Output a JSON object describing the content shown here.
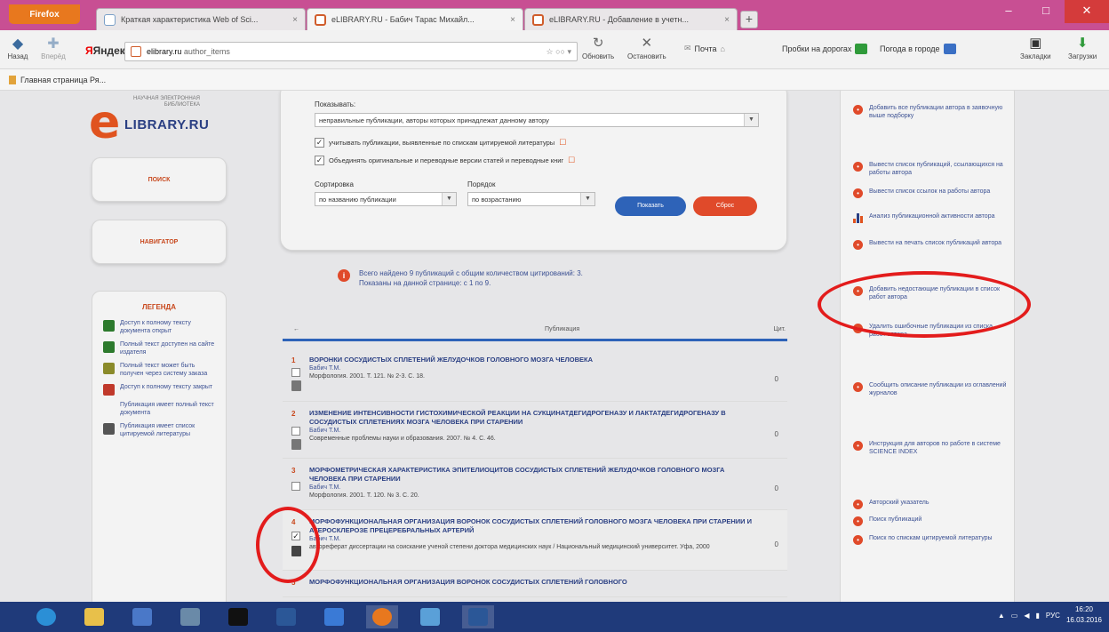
{
  "browser": {
    "firefox_button": "Firefox",
    "tabs": [
      {
        "label": "Краткая характеристика Web of Sci...",
        "active": false
      },
      {
        "label": "eLIBRARY.RU - Бабич Тарас Михайл...",
        "active": true
      },
      {
        "label": "eLIBRARY.RU - Добавление в учетн...",
        "active": false
      }
    ],
    "nav": {
      "back": "Назад",
      "forward": "Вперёд",
      "search_engine": "Яндекс",
      "url_host": "elibrary.ru",
      "url_extra": "author_items",
      "reload": "Обновить",
      "stop": "Остановить",
      "mail": "Почта",
      "traffic": "Пробки на дорогах",
      "weather": "Погода в городе",
      "bookmarks": "Закладки",
      "downloads": "Загрузки"
    },
    "bookmark_bar": "Главная страница Ря..."
  },
  "sidebar": {
    "logo_small": "НАУЧНАЯ ЭЛЕКТРОННАЯ БИБЛИОТЕКА",
    "logo_letter": "e",
    "logo_text": "LIBRARY.RU",
    "button1": "поиск",
    "button2": "навигатор",
    "legend_title": "легенда",
    "legend": [
      {
        "text": "Доступ к полному тексту документа открыт",
        "color": "#2d7a2d"
      },
      {
        "text": "Полный текст доступен на сайте издателя",
        "color": "#2d7a2d"
      },
      {
        "text": "Полный текст может быть получен через систему заказа",
        "color": "#8a8a2a"
      },
      {
        "text": "Доступ к полному тексту закрыт",
        "color": "#c0392b"
      },
      {
        "text": "Публикация имеет полный текст документа",
        "color": "#aaaaaa"
      },
      {
        "text": "Публикация имеет список цитируемой литературы",
        "color": "#555555"
      }
    ]
  },
  "filter": {
    "show_label": "Показывать:",
    "show_value": "неправильные публикации, авторы которых принадлежат данному автору",
    "check1": "учитывать публикации, выявленные по спискам цитируемой литературы",
    "check2": "Объединять оригинальные и переводные версии статей и переводные книг",
    "sort_label": "Сортировка",
    "sort_value": "по названию публикации",
    "order_label": "Порядок",
    "order_value": "по возрастанию",
    "btn_apply": "Показать",
    "btn_reset": "Сброс"
  },
  "summary": {
    "line1": "Всего найдено 9 публикаций с общим количеством цитирований: 3.",
    "line2": "Показаны на данной странице: с 1 по 9."
  },
  "table": {
    "col_left": "←",
    "col_title": "Публикация",
    "col_cit": "Цит."
  },
  "publications": [
    {
      "num": "1",
      "title": "ВОРОНКИ СОСУДИСТЫХ СПЛЕТЕНИЙ ЖЕЛУДОЧКОВ ГОЛОВНОГО МОЗГА ЧЕЛОВЕКА",
      "author": "Бабич Т.М.",
      "source": "Морфология. 2001. Т. 121. № 2-3. С. 18.",
      "cit": "0"
    },
    {
      "num": "2",
      "title": "ИЗМЕНЕНИЕ ИНТЕНСИВНОСТИ ГИСТОХИМИЧЕСКОЙ РЕАКЦИИ НА СУКЦИНАТДЕГИДРОГЕНАЗУ И ЛАКТАТДЕГИДРОГЕНАЗУ В СОСУДИСТЫХ СПЛЕТЕНИЯХ МОЗГА ЧЕЛОВЕКА ПРИ СТАРЕНИИ",
      "author": "Бабич Т.М.",
      "source": "Современные проблемы науки и образования. 2007. № 4. С. 46.",
      "cit": "0"
    },
    {
      "num": "3",
      "title": "МОРФОМЕТРИЧЕСКАЯ ХАРАКТЕРИСТИКА ЭПИТЕЛИОЦИТОВ СОСУДИСТЫХ СПЛЕТЕНИЙ ЖЕЛУДОЧКОВ ГОЛОВНОГО МОЗГА ЧЕЛОВЕКА ПРИ СТАРЕНИИ",
      "author": "Бабич Т.М.",
      "source": "Морфология. 2001. Т. 120. № 3. С. 20.",
      "cit": "0"
    },
    {
      "num": "4",
      "title": "МОРФОФУНКЦИОНАЛЬНАЯ ОРГАНИЗАЦИЯ ВОРОНОК СОСУДИСТЫХ СПЛЕТЕНИЙ ГОЛОВНОГО МОЗГА ЧЕЛОВЕКА ПРИ СТАРЕНИИ И АТЕРОСКЛЕРОЗЕ ПРЕЦЕРЕБРАЛЬНЫХ АРТЕРИЙ",
      "author": "Бабич Т.М.",
      "source": "автореферат диссертации на соискание ученой степени доктора медицинских наук / Национальный медицинский университет. Уфа, 2000",
      "cit": "0"
    },
    {
      "num": "5",
      "title": "МОРФОФУНКЦИОНАЛЬНАЯ ОРГАНИЗАЦИЯ ВОРОНОК СОСУДИСТЫХ СПЛЕТЕНИЙ ГОЛОВНОГО",
      "author": "",
      "source": "",
      "cit": ""
    }
  ],
  "right_panel": [
    {
      "text": "Добавить все публикации автора в заявочную выше подборку"
    },
    {
      "text": "Вывести список публикаций, ссылающихся на работы автора"
    },
    {
      "text": "Вывести список ссылок на работы автора"
    },
    {
      "text": "Анализ публикационной активности автора"
    },
    {
      "text": "Вывести на печать список публикаций автора"
    },
    {
      "text": "Добавить недостающие публикации в список работ автора"
    },
    {
      "text": "Удалить ошибочные публикации из списка работ автора"
    },
    {
      "text": "Сообщить описание публикации из оглавлений журналов"
    },
    {
      "text": "Инструкция для авторов по работе в системе SCIENCE INDEX"
    },
    {
      "text": "Авторский указатель"
    },
    {
      "text": "Поиск публикаций"
    },
    {
      "text": "Поиск по спискам цитируемой литературы"
    }
  ],
  "taskbar": {
    "tray_lang": "РУС",
    "time": "16:20",
    "date": "16.03.2016"
  },
  "colors": {
    "title_bar": "#c84f93",
    "elibrary_orange": "#e0531f",
    "elibrary_blue": "#2a3f83",
    "annotation_red": "#e31c1c",
    "taskbar": "#1f3a7a"
  }
}
